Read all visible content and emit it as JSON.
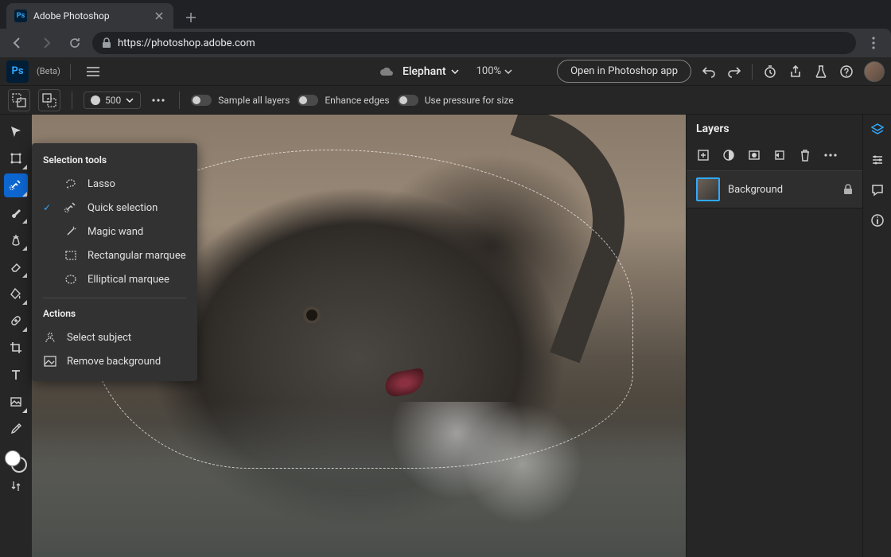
{
  "browser": {
    "tab_title": "Adobe Photoshop",
    "url": "https://photoshop.adobe.com"
  },
  "header": {
    "beta_label": "(Beta)",
    "doc_name": "Elephant",
    "zoom": "100%",
    "open_in_app": "Open in Photoshop app"
  },
  "options": {
    "brush_size": "500",
    "sample_all": "Sample all layers",
    "enhance_edges": "Enhance edges",
    "pressure": "Use pressure for size"
  },
  "flyout": {
    "heading_tools": "Selection tools",
    "items": [
      {
        "label": "Lasso",
        "checked": false,
        "icon": "lasso"
      },
      {
        "label": "Quick selection",
        "checked": true,
        "icon": "quick-select"
      },
      {
        "label": "Magic wand",
        "checked": false,
        "icon": "wand"
      },
      {
        "label": "Rectangular marquee",
        "checked": false,
        "icon": "rect"
      },
      {
        "label": "Elliptical marquee",
        "checked": false,
        "icon": "ellipse"
      }
    ],
    "heading_actions": "Actions",
    "actions": [
      {
        "label": "Select subject",
        "icon": "subject"
      },
      {
        "label": "Remove background",
        "icon": "remove-bg"
      }
    ]
  },
  "layers": {
    "title": "Layers",
    "items": [
      {
        "name": "Background",
        "locked": true
      }
    ]
  }
}
